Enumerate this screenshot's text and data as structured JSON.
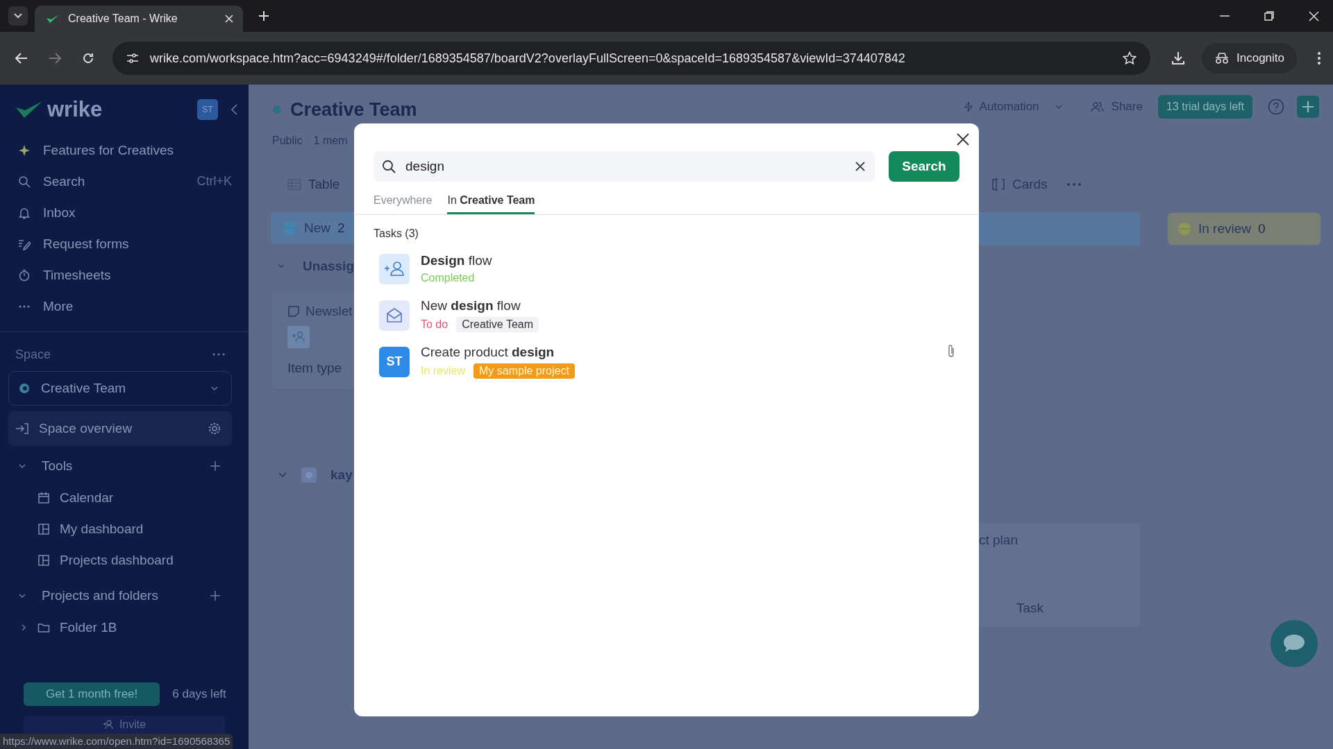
{
  "browser": {
    "tab_title": "Creative Team - Wrike",
    "url": "wrike.com/workspace.htm?acc=6943249#/folder/1689354587/boardV2?overlayFullScreen=0&spaceId=1689354587&viewId=374407842",
    "profile": "Incognito",
    "status_url": "https://www.wrike.com/open.htm?id=1690568365"
  },
  "sidebar": {
    "logo": "wrike",
    "avatar": "ST",
    "nav": [
      {
        "kind": "sparkle",
        "label": "Features for Creatives"
      },
      {
        "kind": "search",
        "label": "Search",
        "shortcut": "Ctrl+K"
      },
      {
        "kind": "bell",
        "label": "Inbox"
      },
      {
        "kind": "form",
        "label": "Request forms"
      },
      {
        "kind": "timer",
        "label": "Timesheets"
      },
      {
        "kind": "dots",
        "label": "More"
      }
    ],
    "space_label": "Space",
    "space_select": "Creative Team",
    "space_overview": "Space overview",
    "sections": [
      {
        "title": "Tools",
        "expanded": true,
        "items": [
          {
            "kind": "calendar",
            "label": "Calendar"
          },
          {
            "kind": "dashboard",
            "label": "My dashboard"
          },
          {
            "kind": "dashboard",
            "label": "Projects dashboard"
          }
        ]
      },
      {
        "title": "Projects and folders",
        "expanded": true,
        "items": [
          {
            "kind": "folder",
            "label": "Folder 1B",
            "expanded": false
          }
        ]
      }
    ],
    "promo_button": "Get 1 month free!",
    "promo_days": "6 days left",
    "invite": "Invite"
  },
  "main": {
    "title": "Creative Team",
    "meta": [
      "Public",
      "1 mem"
    ],
    "automation": "Automation",
    "share": "Share",
    "trial": "13 trial days left",
    "view_left": "Table",
    "view_right": "Cards",
    "left_column": {
      "name": "New",
      "count": "2"
    },
    "group": "Unassig",
    "card": "Newslet",
    "field": "Item type",
    "group2": "kay",
    "right_column": {
      "name": "In review",
      "count": "0"
    },
    "card_title": "ct plan",
    "card_type": "Task"
  },
  "modal": {
    "query": "design",
    "button": "Search",
    "tabs": [
      {
        "label": "Everywhere",
        "selected": false
      },
      {
        "label": "In **Creative Team**",
        "selected": true
      }
    ],
    "section": "Tasks (3)",
    "results": [
      {
        "kind": "assign",
        "title": "**Design** flow",
        "status": {
          "text": "Completed",
          "color": "#7cc95a"
        },
        "attachment": false
      },
      {
        "kind": "mail",
        "title": "New **design** flow",
        "status": {
          "text": "To do",
          "color": "#e0556d"
        },
        "tag": {
          "text": "Creative Team",
          "color": "#f1f2f5"
        },
        "attachment": false
      },
      {
        "kind": "avatar",
        "avatar": "ST",
        "title": "Create product **design**",
        "status": {
          "text": "In review",
          "color": "#e9e75e"
        },
        "tag": {
          "text": "My sample project",
          "color": "#f29a1a"
        },
        "attachment": true
      }
    ]
  }
}
